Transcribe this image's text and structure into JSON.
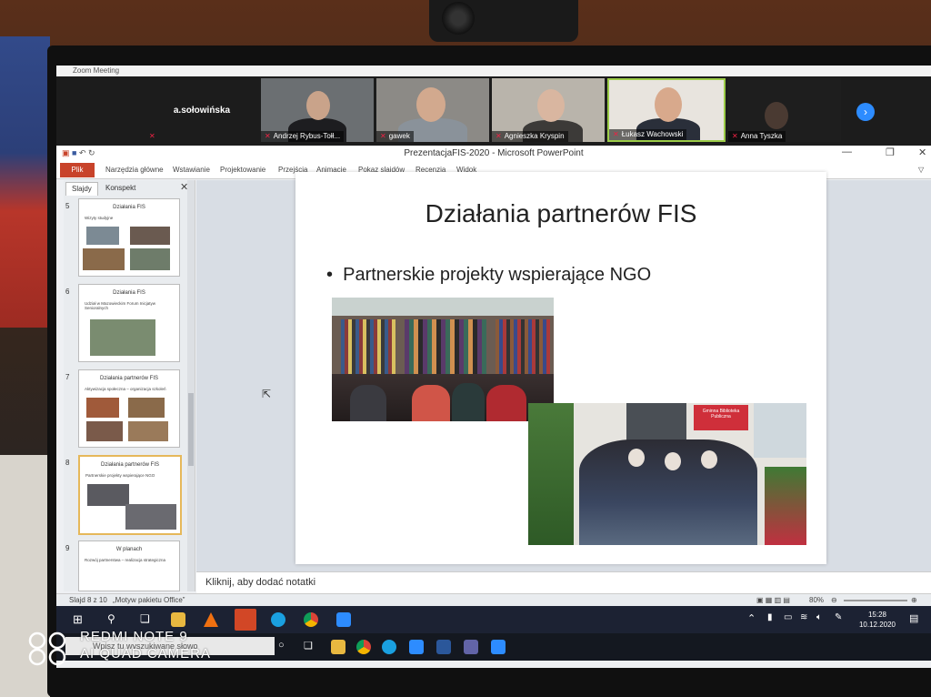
{
  "zoom": {
    "window_title": "Zoom Meeting",
    "participants": [
      {
        "name": "a.sołowińska",
        "video": false
      },
      {
        "name": "Andrzej Rybus-Tołł...",
        "video": true
      },
      {
        "name": "gawek",
        "video": true
      },
      {
        "name": "Agnieszka Kryspin",
        "video": true
      },
      {
        "name": "Łukasz Wachowski",
        "video": true
      },
      {
        "name": "Anna Tyszka",
        "video": true
      }
    ],
    "next_icon": "chevron-right-icon"
  },
  "powerpoint": {
    "title": "PrezentacjaFIS-2020 - Microsoft PowerPoint",
    "ribbon_tabs": [
      "Plik",
      "Narzędzia główne",
      "Wstawianie",
      "Projektowanie",
      "Przejścia",
      "Animacje",
      "Pokaz slajdów",
      "Recenzja",
      "Widok"
    ],
    "pane_tabs": [
      "Slajdy",
      "Konspekt"
    ],
    "thumbnails": [
      {
        "num": "5",
        "title": "Działania FIS",
        "bullet": "Wizyty studyjne"
      },
      {
        "num": "6",
        "title": "Działania FIS",
        "bullet": "Udział w Mazowieckim Forum Inicjatyw Senioralnych"
      },
      {
        "num": "7",
        "title": "Działania partnerów FIS",
        "bullet": "Aktywizacja społeczna – organizacja szkoleń"
      },
      {
        "num": "8",
        "title": "Działania partnerów FIS",
        "bullet": "Partnerskie projekty wspierające NGO"
      },
      {
        "num": "9",
        "title": "W planach",
        "bullet": "Rozwój partnerstwa – realizacja strategiczna"
      }
    ],
    "slide": {
      "title": "Działania partnerów FIS",
      "bullet": "Partnerskie projekty wspierające NGO",
      "sign_text": "Gminna Biblioteka Publiczna"
    },
    "notes_placeholder": "Kliknij, aby dodać notatki",
    "status": {
      "slide": "Slajd 8 z 10",
      "theme": "„Motyw pakietu Office”",
      "zoom": "80%"
    }
  },
  "taskbar": {
    "time": "15:28",
    "date": "10.12.2020",
    "search_placeholder": "Wpisz tu wyszukiwane słowo"
  },
  "watermark": {
    "line1": "REDMI NOTE 9",
    "line2": "AI QUAD CAMERA"
  },
  "colors": {
    "zoom_blue": "#2d8cff",
    "ppt_accent": "#c8432a",
    "selected_thumb": "#e6b85a"
  }
}
